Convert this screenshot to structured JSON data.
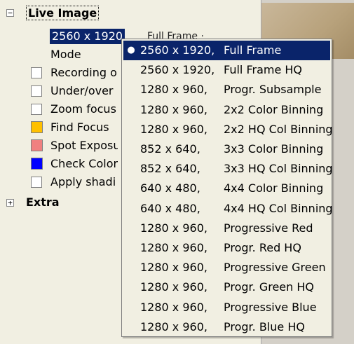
{
  "tree": {
    "live_image": {
      "label": "Live Image",
      "toggle": "−",
      "resolution_value": "2560 x 1920",
      "resolution_mode_partial": "Full Frame ·",
      "items": [
        {
          "label": "Mode",
          "control": "none"
        },
        {
          "label": "Recording o",
          "control": "checkbox",
          "checked": false
        },
        {
          "label": "Under/over",
          "control": "checkbox",
          "checked": false
        },
        {
          "label": "Zoom focus",
          "control": "checkbox",
          "checked": false
        },
        {
          "label": "Find Focus",
          "control": "swatch",
          "color": "#ffc000"
        },
        {
          "label": "Spot Exposu",
          "control": "swatch",
          "color": "#f08080"
        },
        {
          "label": "Check Color",
          "control": "swatch",
          "color": "#0000ff"
        },
        {
          "label": "Apply shadi",
          "control": "checkbox",
          "checked": false
        }
      ]
    },
    "extra": {
      "label": "Extra",
      "toggle": "+"
    }
  },
  "dropdown": {
    "selected_index": 0,
    "options": [
      {
        "resolution": "2560 x 1920,",
        "mode": "Full Frame"
      },
      {
        "resolution": "2560 x 1920,",
        "mode": "Full Frame HQ"
      },
      {
        "resolution": "1280 x 960,",
        "mode": "Progr. Subsample"
      },
      {
        "resolution": "1280 x 960,",
        "mode": "2x2 Color Binning"
      },
      {
        "resolution": "1280 x 960,",
        "mode": "2x2 HQ Col Binning"
      },
      {
        "resolution": "852 x 640,",
        "mode": "3x3 Color Binning"
      },
      {
        "resolution": "852 x 640,",
        "mode": "3x3 HQ Col Binning"
      },
      {
        "resolution": "640 x 480,",
        "mode": "4x4 Color Binning"
      },
      {
        "resolution": "640 x 480,",
        "mode": "4x4 HQ Col Binning"
      },
      {
        "resolution": "1280 x 960,",
        "mode": "Progressive Red"
      },
      {
        "resolution": "1280 x 960,",
        "mode": "Progr.  Red HQ"
      },
      {
        "resolution": "1280 x 960,",
        "mode": "Progressive Green"
      },
      {
        "resolution": "1280 x 960,",
        "mode": "Progr.  Green HQ"
      },
      {
        "resolution": "1280 x 960,",
        "mode": "Progressive Blue"
      },
      {
        "resolution": "1280 x 960,",
        "mode": "Progr.  Blue HQ"
      }
    ]
  },
  "colors": {
    "selection": "#0a246a",
    "panel_background": "#f1efe2"
  },
  "icons": {
    "collapse": "minus-box-icon",
    "expand": "plus-box-icon",
    "selected_bullet": "bullet-icon"
  }
}
